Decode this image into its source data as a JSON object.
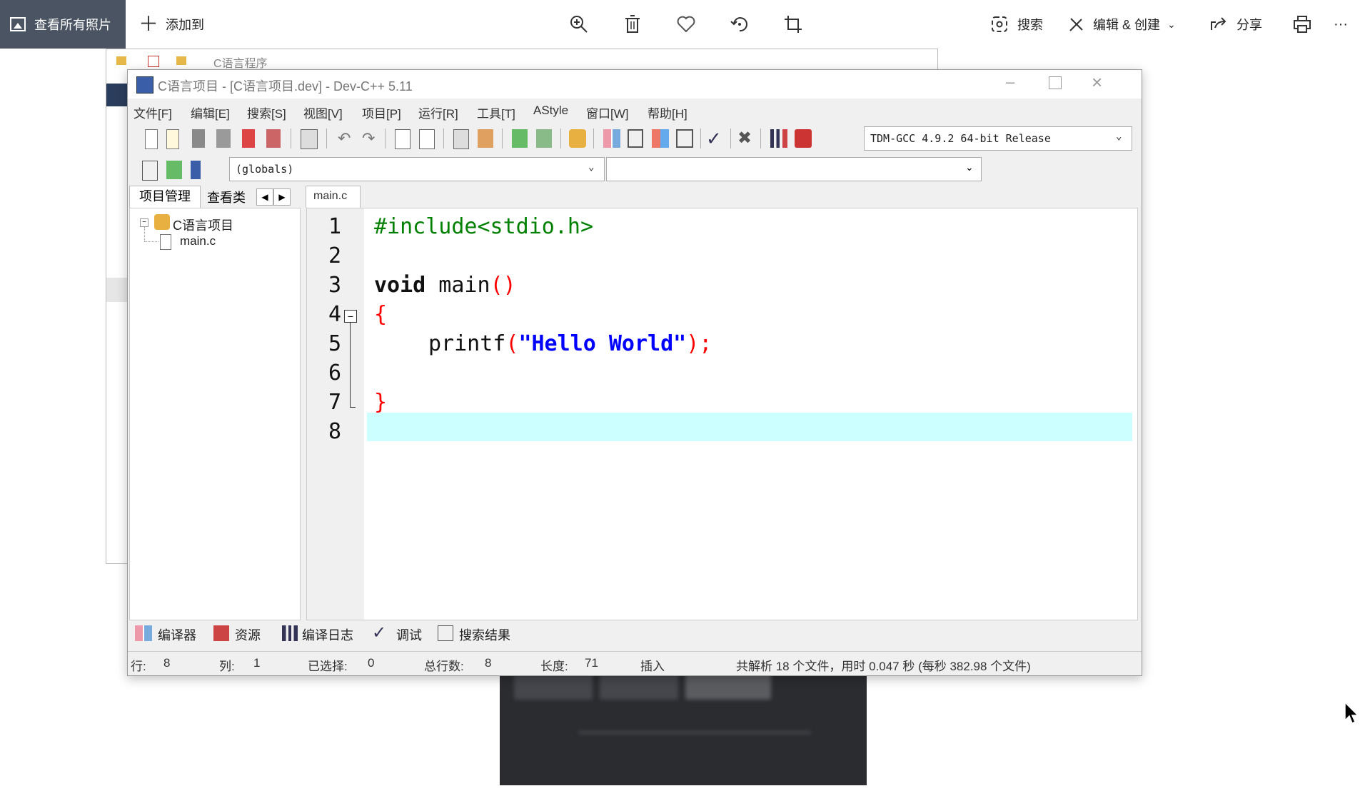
{
  "photos_app": {
    "view_all_label": "查看所有照片",
    "add_to_label": "添加到",
    "search_label": "搜索",
    "edit_create_label": "编辑 & 创建",
    "share_label": "分享",
    "more_label": "···"
  },
  "background_window": {
    "title": "C语言程序"
  },
  "devcpp": {
    "title": "C语言项目 - [C语言项目.dev] - Dev-C++ 5.11",
    "menu": [
      "文件[F]",
      "编辑[E]",
      "搜索[S]",
      "视图[V]",
      "项目[P]",
      "运行[R]",
      "工具[T]",
      "AStyle",
      "窗口[W]",
      "帮助[H]"
    ],
    "compiler": "TDM-GCC 4.9.2 64-bit Release",
    "scope": "(globals)",
    "side_tabs": {
      "project": "项目管理",
      "classes": "查看类"
    },
    "tree": {
      "project_name": "C语言项目",
      "file": "main.c"
    },
    "editor_tab": "main.c",
    "line_numbers": [
      "1",
      "2",
      "3",
      "4",
      "5",
      "6",
      "7",
      "8"
    ],
    "code": {
      "line1": "#include<stdio.h>",
      "line3_kw": "void",
      "line3_rest": " main",
      "line3_paren": "()",
      "line4": "{",
      "line5_fn": "printf",
      "line5_open": "(",
      "line5_str": "\"Hello World\"",
      "line5_close": ");",
      "line7": "}"
    },
    "bottom_tabs": [
      "编译器",
      "资源",
      "编译日志",
      "调试",
      "搜索结果"
    ],
    "status": {
      "row_label": "行:",
      "row": "8",
      "col_label": "列:",
      "col": "1",
      "sel_label": "已选择:",
      "sel": "0",
      "total_label": "总行数:",
      "total": "8",
      "len_label": "长度:",
      "len": "71",
      "mode": "插入",
      "parse_info": "共解析 18 个文件，用时 0.047 秒 (每秒 382.98 个文件)"
    },
    "colors": {
      "preprocessor": "#008000",
      "brace": "#ff0000",
      "string": "#0000ff",
      "active_line": "#ccffff"
    }
  }
}
